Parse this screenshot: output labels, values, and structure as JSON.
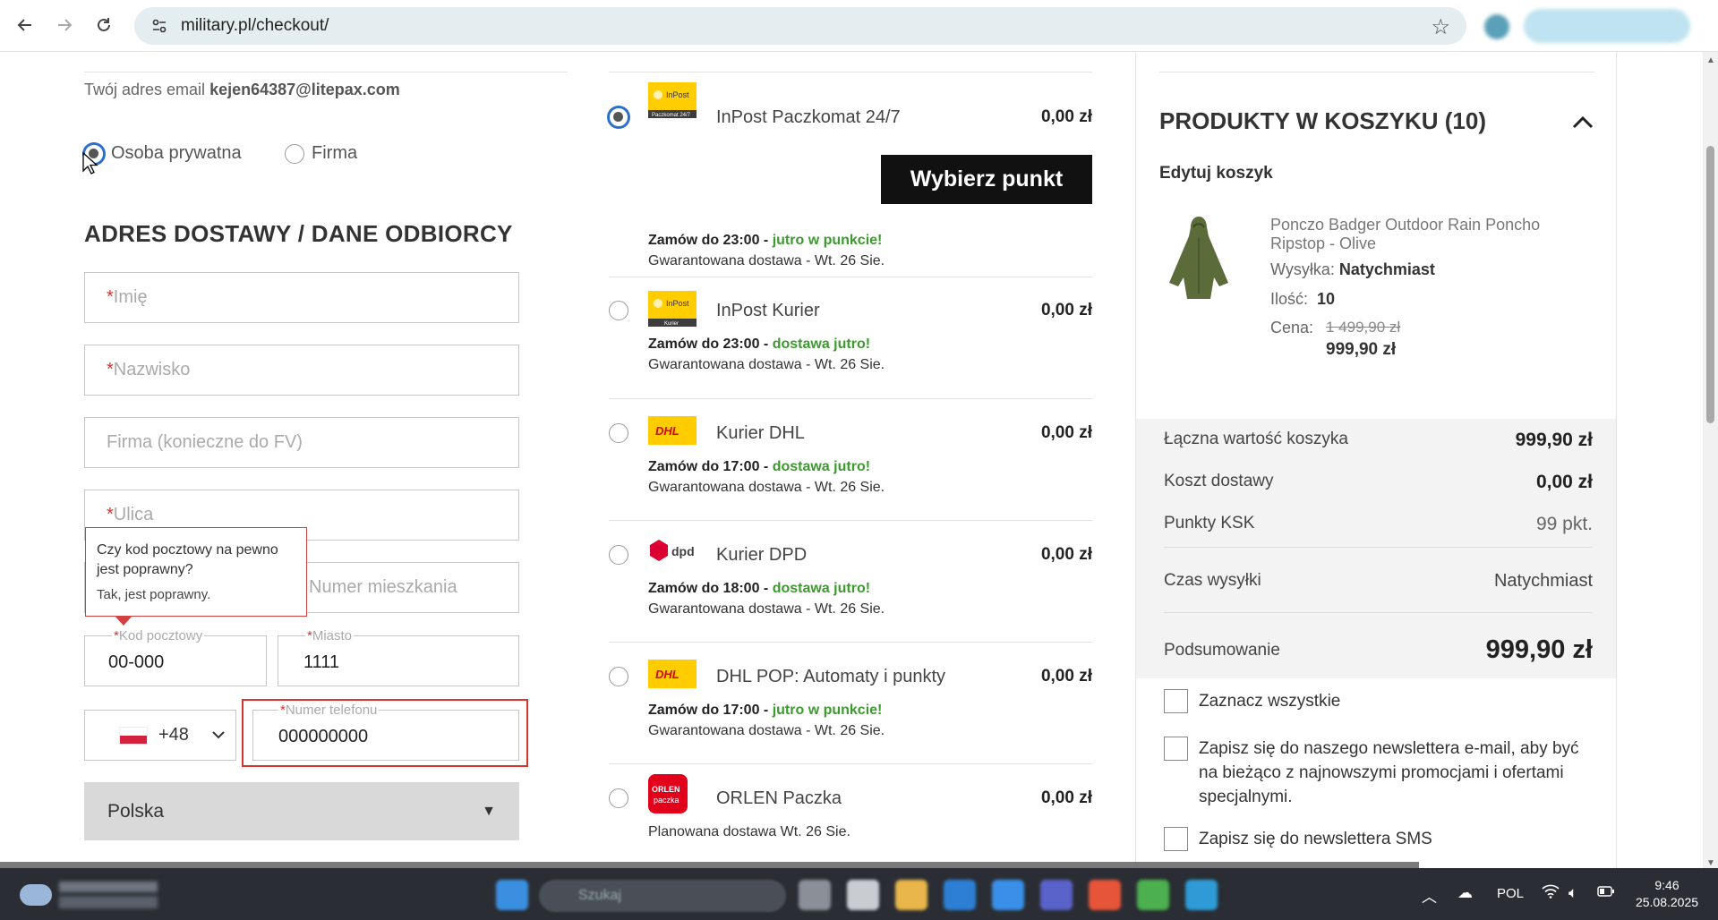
{
  "browser": {
    "url": "military.pl/checkout/"
  },
  "form": {
    "email_label": "Twój adres email",
    "email_value": "kejen64387@litepax.com",
    "customer_type": [
      {
        "label": "Osoba prywatna",
        "selected": true
      },
      {
        "label": "Firma",
        "selected": false
      }
    ],
    "section_title": "ADRES DOSTAWY / DANE ODBIORCY",
    "required_mark": "*",
    "first_name_placeholder": "Imię",
    "last_name_placeholder": "Nazwisko",
    "company_placeholder": "Firma (konieczne do FV)",
    "street_placeholder": "Ulica",
    "apartment_placeholder": "Numer mieszkania",
    "postcode_label": "Kod pocztowy",
    "postcode_value": "00-000",
    "city_label": "Miasto",
    "city_value": "1111",
    "phone_prefix": "+48",
    "phone_label": "Numer telefonu",
    "phone_value": "000000000",
    "country": "Polska",
    "tooltip": {
      "question": "Czy kod pocztowy na pewno jest poprawny?",
      "confirm": "Tak, jest poprawny."
    }
  },
  "shipping": {
    "choose_point_button": "Wybierz punkt",
    "options": [
      {
        "name": "InPost Paczkomat 24/7",
        "price": "0,00 zł",
        "selected": true,
        "order_by": "Zamów do 23:00 -",
        "highlight": "jutro w punkcie!",
        "delivery": "Gwarantowana dostawa - Wt. 26 Sie.",
        "logo": "inpost-paczkomat-logo",
        "logo_text": "InPost",
        "logo_sub": "Paczkomat 24/7"
      },
      {
        "name": "InPost Kurier",
        "price": "0,00 zł",
        "selected": false,
        "order_by": "Zamów do 23:00 -",
        "highlight": "dostawa jutro!",
        "delivery": "Gwarantowana dostawa - Wt. 26 Sie.",
        "logo": "inpost-kurier-logo",
        "logo_text": "InPost",
        "logo_sub": "Kurier"
      },
      {
        "name": "Kurier DHL",
        "price": "0,00 zł",
        "selected": false,
        "order_by": "Zamów do 17:00 -",
        "highlight": "dostawa jutro!",
        "delivery": "Gwarantowana dostawa - Wt. 26 Sie.",
        "logo": "dhl-logo",
        "logo_text": "DHL"
      },
      {
        "name": "Kurier DPD",
        "price": "0,00 zł",
        "selected": false,
        "order_by": "Zamów do 18:00 -",
        "highlight": "dostawa jutro!",
        "delivery": "Gwarantowana dostawa - Wt. 26 Sie.",
        "logo": "dpd-logo",
        "logo_text": "dpd"
      },
      {
        "name": "DHL POP: Automaty i punkty",
        "price": "0,00 zł",
        "selected": false,
        "order_by": "Zamów do 17:00 -",
        "highlight": "jutro w punkcie!",
        "delivery": "Gwarantowana dostawa - Wt. 26 Sie.",
        "logo": "dhl-logo",
        "logo_text": "DHL"
      },
      {
        "name": "ORLEN Paczka",
        "price": "0,00 zł",
        "selected": false,
        "delivery": "Planowana dostawa Wt. 26 Sie.",
        "logo": "orlen-paczka-logo",
        "logo_text": "ORLEN",
        "logo_sub": "paczka"
      }
    ]
  },
  "cart": {
    "title": "PRODUKTY W KOSZYKU (10)",
    "edit_label": "Edytuj koszyk",
    "product": {
      "name": "Ponczo Badger Outdoor Rain Poncho Ripstop - Olive",
      "shipping_label": "Wysyłka:",
      "shipping_value": "Natychmiast",
      "qty_label": "Ilość:",
      "qty_value": "10",
      "price_label": "Cena:",
      "old_price": "1 499,90 zł",
      "new_price": "999,90 zł"
    },
    "summary": [
      {
        "label": "Łączna wartość koszyka",
        "value": "999,90 zł"
      },
      {
        "label": "Koszt dostawy",
        "value": "0,00 zł"
      },
      {
        "label": "Punkty KSK",
        "value": "99 pkt."
      },
      {
        "label": "Czas wysyłki",
        "value": "Natychmiast"
      }
    ],
    "total_label": "Podsumowanie",
    "total_value": "999,90 zł",
    "consents": [
      "Zaznacz wszystkie",
      "Zapisz się do naszego newslettera e-mail, aby być na bieżąco z najnowszymi promocjami i ofertami specjalnymi.",
      "Zapisz się do newslettera SMS"
    ]
  },
  "taskbar": {
    "search_placeholder": "Szukaj",
    "language": "POL",
    "time": "9:46",
    "date": "25.08.2025"
  },
  "colors": {
    "accent_green": "#3c9a2e",
    "error_red": "#d8342c",
    "button_black": "#111111"
  }
}
